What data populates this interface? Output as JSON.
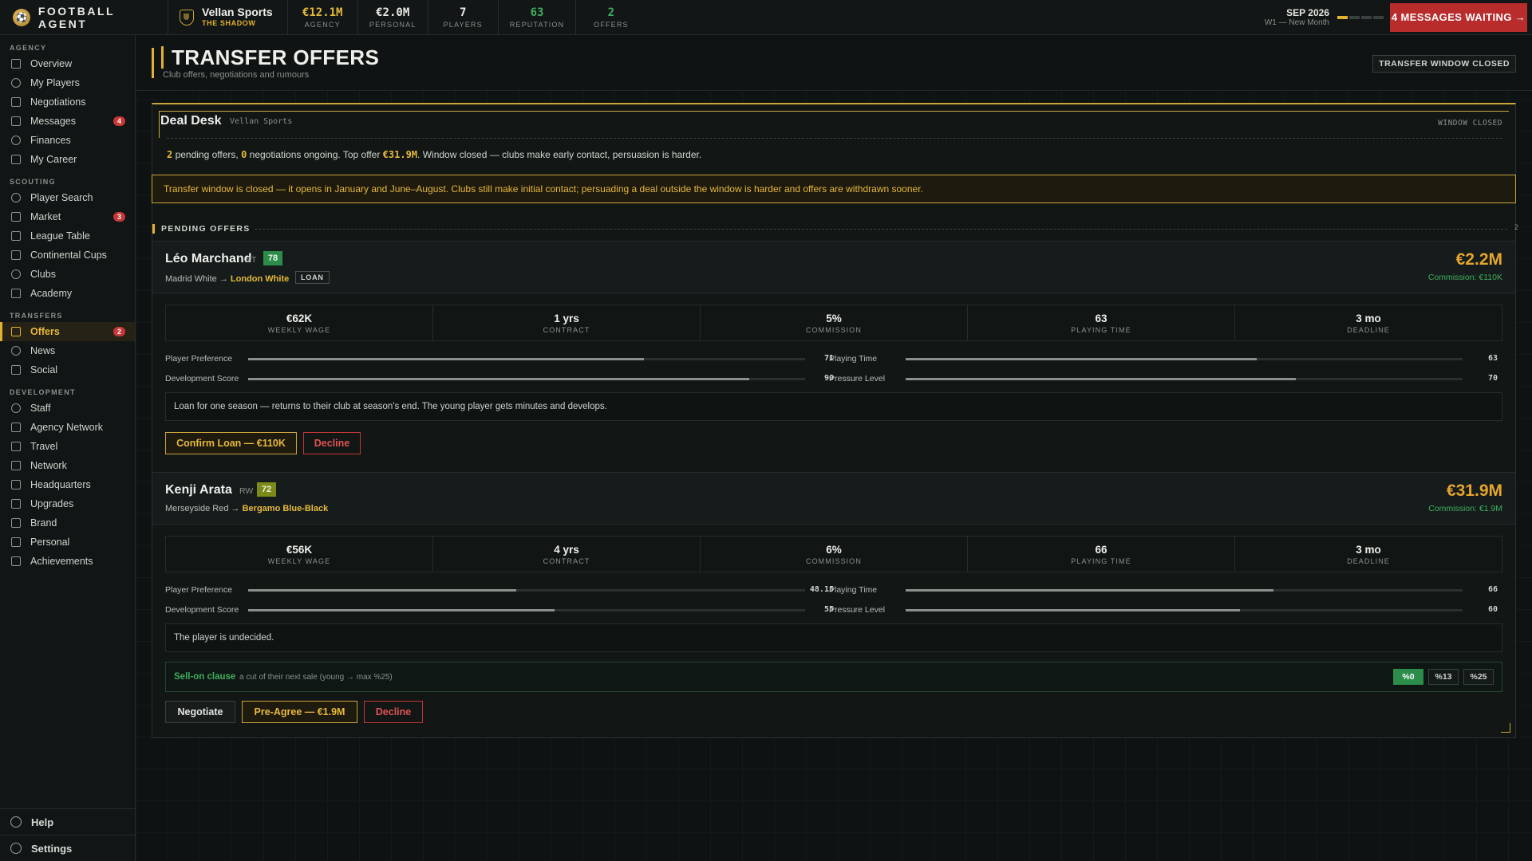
{
  "brand": {
    "name": "FOOTBALL AGENT"
  },
  "agency": {
    "name": "Vellan Sports",
    "tagline": "THE SHADOW"
  },
  "stats": [
    {
      "value": "€12.1M",
      "label": "AGENCY",
      "color": "#e6b93a"
    },
    {
      "value": "€2.0M",
      "label": "PERSONAL",
      "color": "#e8ebe4"
    },
    {
      "value": "7",
      "label": "PLAYERS",
      "color": "#e8ebe4"
    },
    {
      "value": "63",
      "label": "REPUTATION",
      "color": "#3fae5d"
    },
    {
      "value": "2",
      "label": "OFFERS",
      "color": "#3fae5d"
    }
  ],
  "date": {
    "main": "SEP 2026",
    "sub": "W1 — New Month",
    "weeks_total": 4,
    "weeks_done": 1
  },
  "messages_button": "4 MESSAGES WAITING →",
  "sidebar": {
    "sections": [
      {
        "title": "AGENCY",
        "items": [
          {
            "label": "Overview",
            "icon": "grid-icon"
          },
          {
            "label": "My Players",
            "icon": "user-icon"
          },
          {
            "label": "Negotiations",
            "icon": "chat-icon"
          },
          {
            "label": "Messages",
            "icon": "mail-icon",
            "badge": "4"
          },
          {
            "label": "Finances",
            "icon": "euro-icon"
          },
          {
            "label": "My Career",
            "icon": "figure-icon"
          }
        ]
      },
      {
        "title": "SCOUTING",
        "items": [
          {
            "label": "Player Search",
            "icon": "search-icon"
          },
          {
            "label": "Market",
            "icon": "broadcast-icon",
            "badge": "3"
          },
          {
            "label": "League Table",
            "icon": "table-icon"
          },
          {
            "label": "Continental Cups",
            "icon": "trophy-icon"
          },
          {
            "label": "Clubs",
            "icon": "shield-icon"
          },
          {
            "label": "Academy",
            "icon": "cap-icon"
          }
        ]
      },
      {
        "title": "TRANSFERS",
        "items": [
          {
            "label": "Offers",
            "icon": "swap-icon",
            "badge": "2",
            "active": true
          },
          {
            "label": "News",
            "icon": "globe-icon"
          },
          {
            "label": "Social",
            "icon": "broadcast-icon"
          }
        ]
      },
      {
        "title": "DEVELOPMENT",
        "items": [
          {
            "label": "Staff",
            "icon": "users-icon"
          },
          {
            "label": "Agency Network",
            "icon": "network-icon"
          },
          {
            "label": "Travel",
            "icon": "plane-icon"
          },
          {
            "label": "Network",
            "icon": "network-icon"
          },
          {
            "label": "Headquarters",
            "icon": "building-icon"
          },
          {
            "label": "Upgrades",
            "icon": "trend-icon"
          },
          {
            "label": "Brand",
            "icon": "star-icon"
          },
          {
            "label": "Personal",
            "icon": "gem-icon"
          },
          {
            "label": "Achievements",
            "icon": "figure-icon"
          }
        ]
      }
    ],
    "footer": [
      {
        "label": "Help",
        "icon": "help-icon"
      },
      {
        "label": "Settings",
        "icon": "gear-icon"
      }
    ]
  },
  "page": {
    "title": "TRANSFER OFFERS",
    "subtitle": "Club offers, negotiations and rumours",
    "window_tag": "TRANSFER WINDOW CLOSED"
  },
  "desk": {
    "title": "Deal Desk",
    "agency": "Vellan Sports",
    "status": "WINDOW CLOSED",
    "pending": "2",
    "ongoing": "0",
    "top_offer": "€31.9M",
    "summary_a": " pending offers, ",
    "summary_b": " negotiations ongoing. Top offer ",
    "summary_c": ". Window closed — clubs make early contact, persuasion is harder.",
    "warning": "Transfer window is closed — it opens in January and June–August. Clubs still make initial contact; persuading a deal outside the window is harder and offers are withdrawn sooner."
  },
  "pending_section": {
    "title": "PENDING OFFERS",
    "count": "2"
  },
  "offers": [
    {
      "name": "Léo Marchand",
      "pos": "ST",
      "ovr": "78",
      "from": "Madrid White",
      "arrow": " → ",
      "to": "London White",
      "tag": "LOAN",
      "fee": "€2.2M",
      "commission": "Commission: €110K",
      "kpis": [
        {
          "value": "€62K",
          "label": "WEEKLY WAGE"
        },
        {
          "value": "1 yrs",
          "label": "CONTRACT"
        },
        {
          "value": "5%",
          "label": "COMMISSION"
        },
        {
          "value": "63",
          "label": "PLAYING TIME"
        },
        {
          "value": "3 mo",
          "label": "DEADLINE"
        }
      ],
      "bars": [
        {
          "label": "Player Preference",
          "value": "71",
          "fill": 71
        },
        {
          "label": "Playing Time",
          "value": "63",
          "fill": 63
        },
        {
          "label": "Development Score",
          "value": "90",
          "fill": 90
        },
        {
          "label": "Pressure Level",
          "value": "70",
          "fill": 70
        }
      ],
      "note": "Loan for one season — returns to their club at season's end. The young player gets minutes and develops.",
      "actions": {
        "confirm": "Confirm Loan — €110K",
        "decline": "Decline"
      }
    },
    {
      "name": "Kenji Arata",
      "pos": "RW",
      "ovr": "72",
      "from": "Merseyside Red",
      "arrow": " → ",
      "to": "Bergamo Blue-Black",
      "fee": "€31.9M",
      "commission": "Commission: €1.9M",
      "kpis": [
        {
          "value": "€56K",
          "label": "WEEKLY WAGE"
        },
        {
          "value": "4 yrs",
          "label": "CONTRACT"
        },
        {
          "value": "6%",
          "label": "COMMISSION"
        },
        {
          "value": "66",
          "label": "PLAYING TIME"
        },
        {
          "value": "3 mo",
          "label": "DEADLINE"
        }
      ],
      "bars": [
        {
          "label": "Player Preference",
          "value": "48.15",
          "fill": 48.15
        },
        {
          "label": "Playing Time",
          "value": "66",
          "fill": 66
        },
        {
          "label": "Development Score",
          "value": "55",
          "fill": 55
        },
        {
          "label": "Pressure Level",
          "value": "60",
          "fill": 60
        }
      ],
      "note": "The player is undecided.",
      "sellon": {
        "title": "Sell-on clause",
        "desc": "a cut of their next sale (young → max %25)",
        "options": [
          "%0",
          "%13",
          "%25"
        ],
        "selected": "%0"
      },
      "actions": {
        "negotiate": "Negotiate",
        "preagree": "Pre-Agree — €1.9M",
        "decline": "Decline"
      }
    }
  ]
}
